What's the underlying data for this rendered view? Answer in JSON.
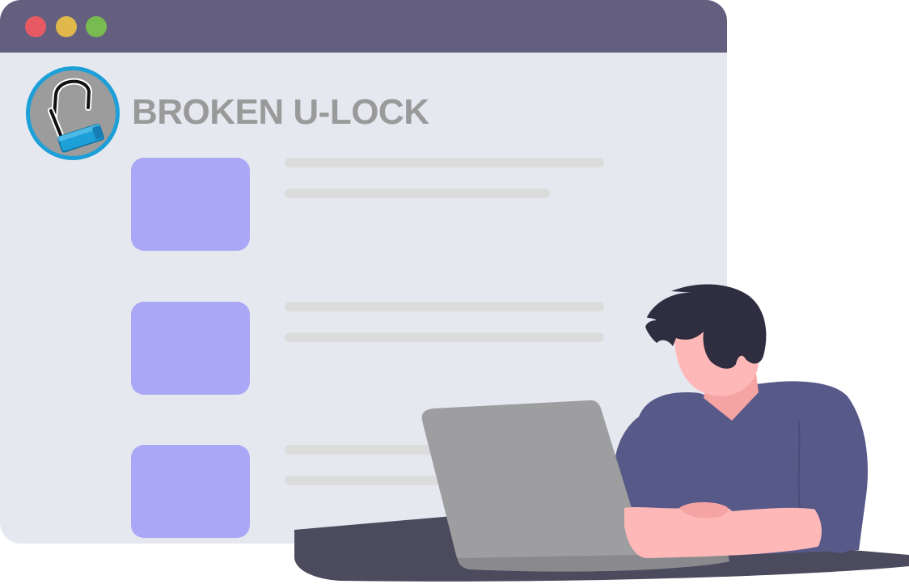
{
  "brand": {
    "title": "BROKEN U-LOCK"
  },
  "window": {
    "controls": [
      "close",
      "minimize",
      "maximize"
    ]
  },
  "list": {
    "item_count": 3
  },
  "colors": {
    "titlebar": "#655f7f",
    "window_bg": "#e6e8f0",
    "close_dot": "#e85a63",
    "minimize_dot": "#e0b84c",
    "maximize_dot": "#78bb50",
    "card": "#aba7f7",
    "placeholder_line": "#dcdcdc",
    "logo_ring": "#1d9fd8",
    "person_shirt": "#575a89",
    "person_skin": "#ffb8b8",
    "person_hair": "#2f2e41",
    "laptop": "#9e9ea1",
    "desk": "#4c4b5e"
  },
  "icons": {
    "logo": "broken-u-lock-icon"
  }
}
